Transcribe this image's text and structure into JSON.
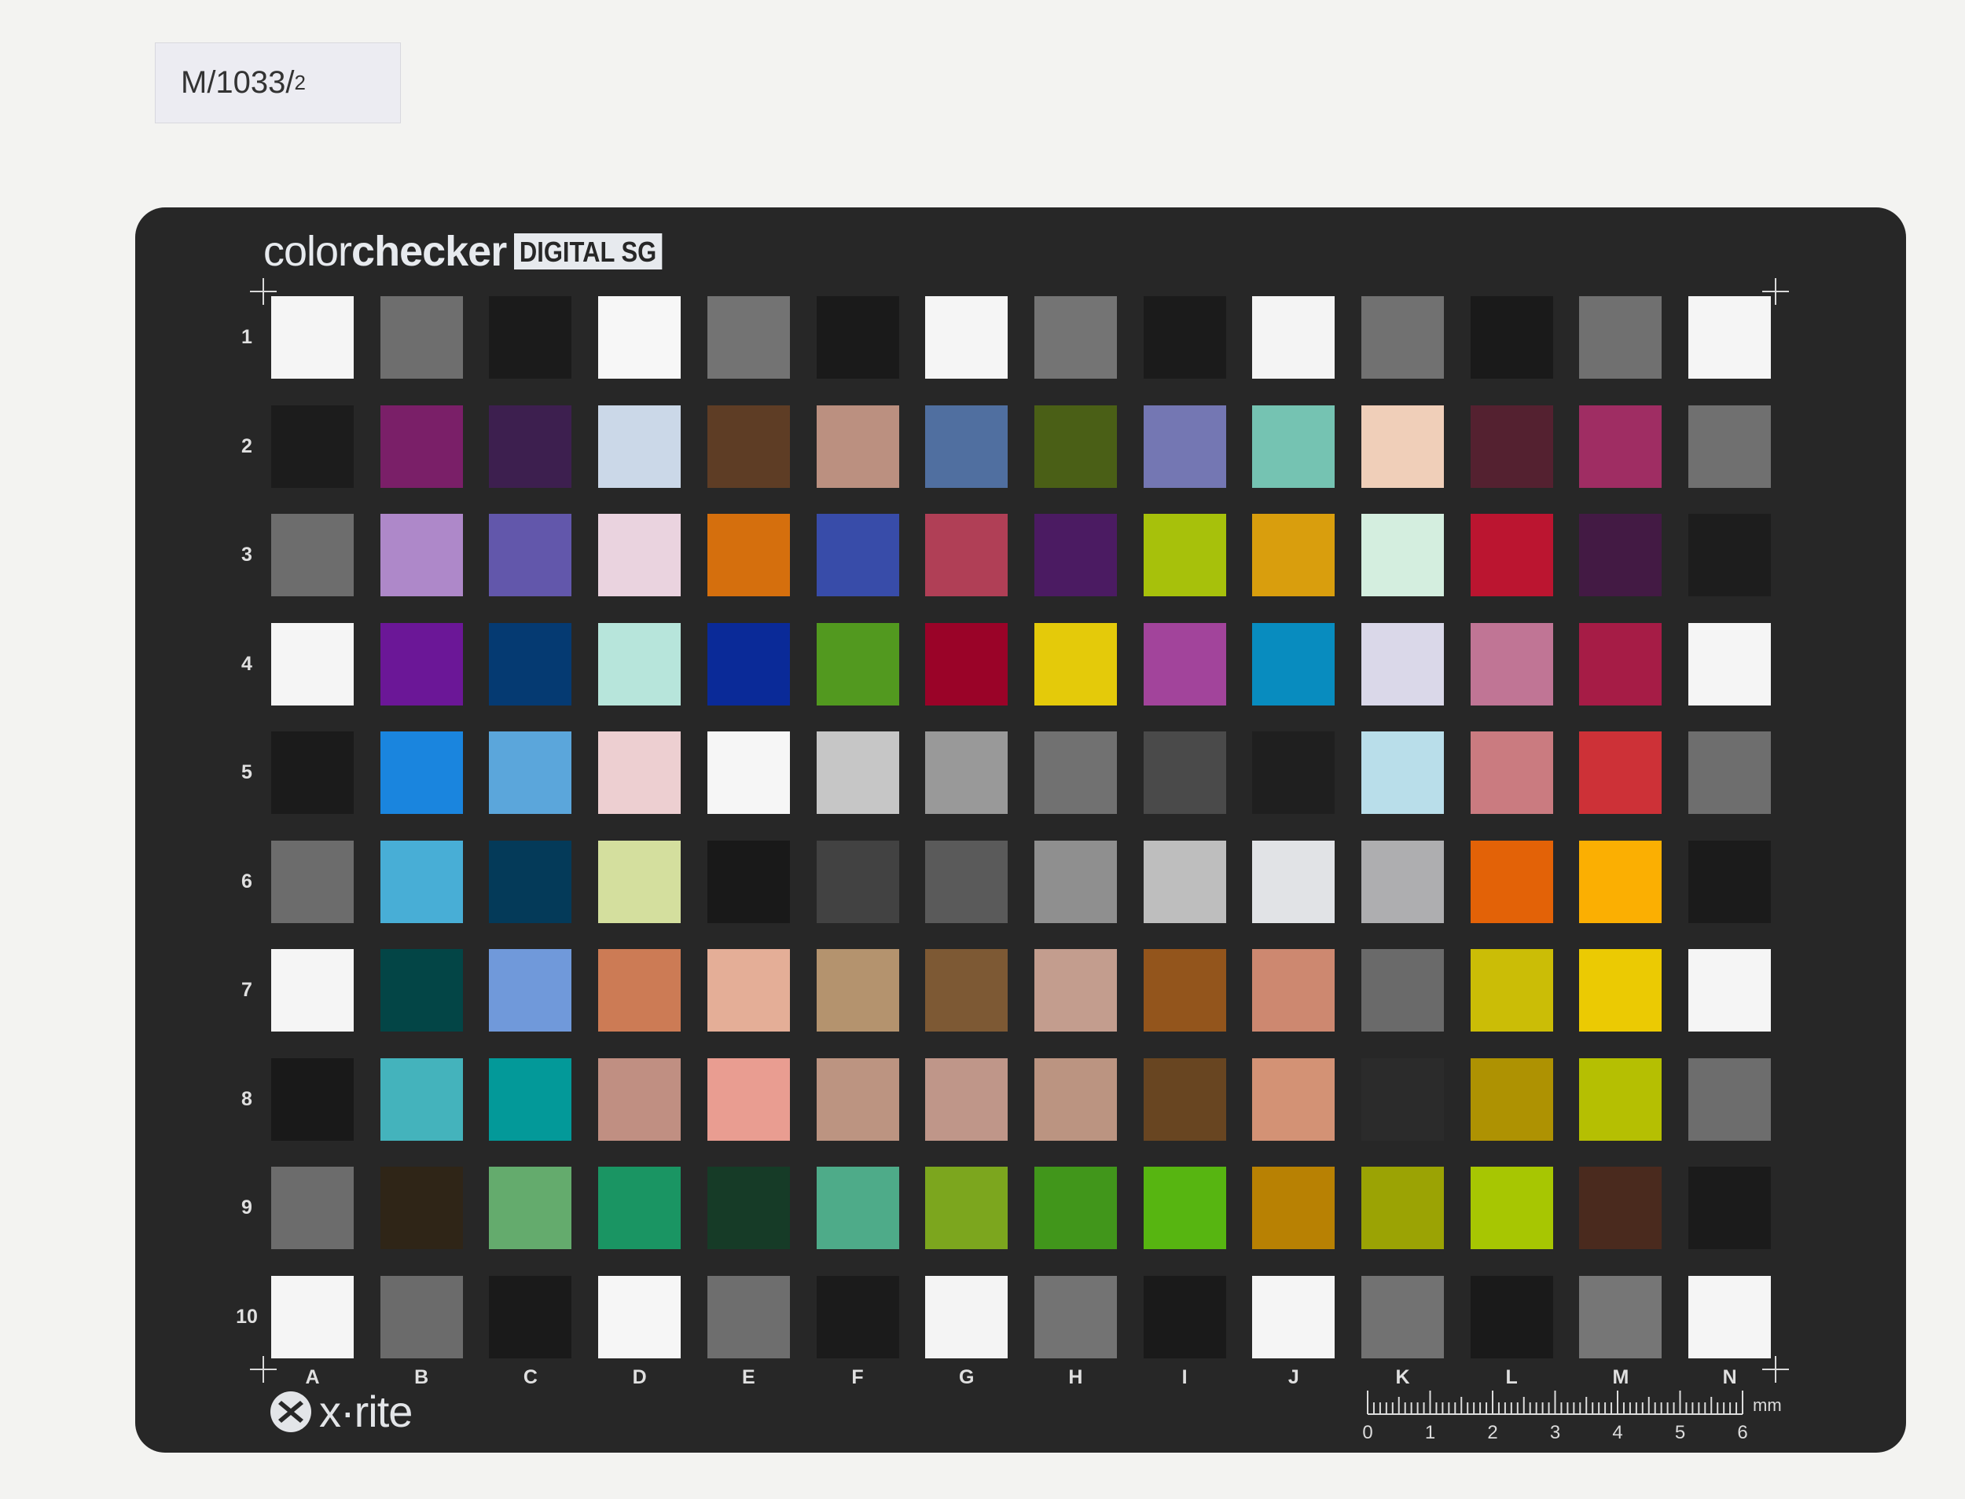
{
  "label": {
    "main": "M/1033/",
    "sub": "2"
  },
  "brand": {
    "light": "color",
    "bold": "checker",
    "tag": "DIGITAL SG"
  },
  "logo": {
    "text": "x·rite",
    "icon": "xrite-x-icon"
  },
  "rows": [
    "1",
    "2",
    "3",
    "4",
    "5",
    "6",
    "7",
    "8",
    "9",
    "10"
  ],
  "columns": [
    "A",
    "B",
    "C",
    "D",
    "E",
    "F",
    "G",
    "H",
    "I",
    "J",
    "K",
    "L",
    "M",
    "N"
  ],
  "ruler": {
    "unit": "mm",
    "numbers": [
      "0",
      "1",
      "2",
      "3",
      "4",
      "5",
      "6"
    ]
  },
  "patches": [
    [
      "#f5f5f5",
      "#6e6e6e",
      "#1b1b1b",
      "#f7f7f7",
      "#737373",
      "#1a1a1a",
      "#f5f5f5",
      "#747474",
      "#1b1b1b",
      "#f4f4f4",
      "#717171",
      "#1a1a1a",
      "#707070",
      "#f5f5f5"
    ],
    [
      "#1c1c1c",
      "#7a1f68",
      "#3d1f4f",
      "#cbd8e8",
      "#5e3d25",
      "#bb9080",
      "#506fa0",
      "#4a5f16",
      "#7477b3",
      "#75c3b2",
      "#f0cfb9",
      "#542130",
      "#9f2d63",
      "#707070"
    ],
    [
      "#6d6d6d",
      "#ae88c9",
      "#6257ab",
      "#ead3df",
      "#d56f0d",
      "#384ca9",
      "#b03f56",
      "#4b1b62",
      "#a7c10b",
      "#d99e0d",
      "#d4eedf",
      "#bb1530",
      "#431a44",
      "#1d1d1d"
    ],
    [
      "#f5f5f5",
      "#6b1797",
      "#053a72",
      "#b7e5db",
      "#0a2a98",
      "#52991f",
      "#9a0328",
      "#e4ca0a",
      "#a2449b",
      "#088cbf",
      "#dad8e9",
      "#c07595",
      "#a61c46",
      "#f5f5f5"
    ],
    [
      "#1b1b1b",
      "#1a85de",
      "#5ba6db",
      "#edcfd1",
      "#f6f6f6",
      "#c6c6c6",
      "#999999",
      "#717171",
      "#4a4a4a",
      "#1f1f1f",
      "#b9deea",
      "#ca7b80",
      "#cd3137",
      "#6e6e6e"
    ],
    [
      "#6c6c6c",
      "#48aed6",
      "#043a59",
      "#d4df9e",
      "#191919",
      "#424242",
      "#5a5a5a",
      "#8f8f8f",
      "#bebebe",
      "#e1e3e6",
      "#aeaeb0",
      "#e36207",
      "#fbaf02",
      "#1b1b1b"
    ],
    [
      "#f5f5f5",
      "#034546",
      "#7099da",
      "#cc7b55",
      "#e4ae97",
      "#b4936e",
      "#7d5934",
      "#c39d8e",
      "#93551c",
      "#cd8870",
      "#6a6a6a",
      "#cbbd06",
      "#ebca03",
      "#f5f5f5"
    ],
    [
      "#191919",
      "#44b3bc",
      "#039999",
      "#c08f82",
      "#e99d91",
      "#bc9481",
      "#bf9689",
      "#bb9481",
      "#684521",
      "#d39275",
      "#2b2b2b",
      "#ae9202",
      "#b5bf02",
      "#6d6d6d"
    ],
    [
      "#6c6c6c",
      "#2f2517",
      "#64ab6d",
      "#1a9563",
      "#163b27",
      "#4eab89",
      "#7ca61e",
      "#41961b",
      "#57b511",
      "#b88103",
      "#9ba304",
      "#a7c602",
      "#4a2a1e",
      "#1b1b1b"
    ],
    [
      "#f5f5f5",
      "#6b6b6b",
      "#1a1a1a",
      "#f6f6f6",
      "#6e6e6e",
      "#1b1b1b",
      "#f4f4f4",
      "#737373",
      "#1a1a1a",
      "#f5f5f5",
      "#727272",
      "#1a1a1a",
      "#767676",
      "#f5f5f5"
    ]
  ]
}
